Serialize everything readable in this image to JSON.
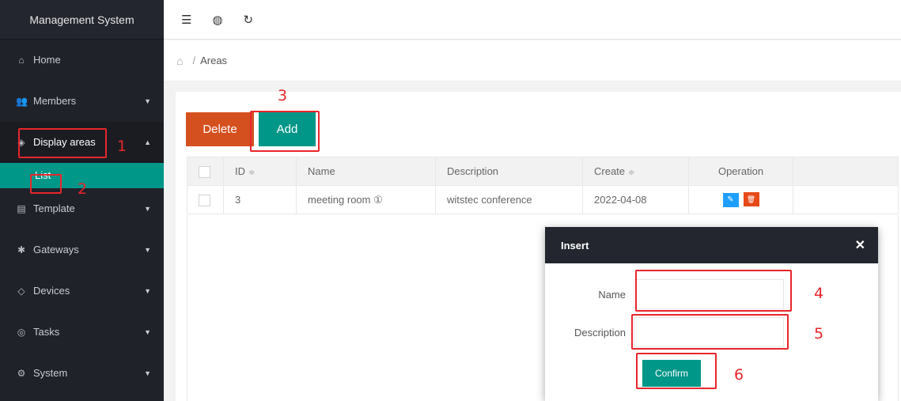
{
  "sidebar": {
    "brand": "Management System",
    "items": [
      {
        "label": "Home",
        "icon": "home-icon",
        "glyph": "⌂"
      },
      {
        "label": "Members",
        "icon": "members-icon",
        "glyph": "👥"
      },
      {
        "label": "Display areas",
        "icon": "layers-icon",
        "glyph": "◈"
      },
      {
        "label": "Template",
        "icon": "template-icon",
        "glyph": "▤"
      },
      {
        "label": "Gateways",
        "icon": "gateway-icon",
        "glyph": "✱"
      },
      {
        "label": "Devices",
        "icon": "tag-icon",
        "glyph": "◇"
      },
      {
        "label": "Tasks",
        "icon": "target-icon",
        "glyph": "◎"
      },
      {
        "label": "System",
        "icon": "gear-icon",
        "glyph": "⚙"
      }
    ],
    "sub_items": [
      {
        "label": "List"
      }
    ]
  },
  "topbar": {
    "menu_icon": "☰",
    "globe_icon": "◍",
    "refresh_icon": "↻"
  },
  "breadcrumb": {
    "home_icon": "⌂",
    "separator": "/",
    "current": "Areas"
  },
  "toolbar": {
    "delete_label": "Delete",
    "add_label": "Add"
  },
  "table": {
    "headers": [
      "ID",
      "Name",
      "Description",
      "Create",
      "Operation"
    ],
    "sort_icon": "≑",
    "rows": [
      {
        "id": "3",
        "name": "meeting room ①",
        "description": "witstec conference",
        "create": "2022-04-08"
      }
    ],
    "edit_icon": "✎",
    "delete_icon": "🗑"
  },
  "modal": {
    "title": "Insert",
    "close_icon": "✕",
    "name_label": "Name",
    "name_value": "",
    "description_label": "Description",
    "description_value": "",
    "confirm_label": "Confirm"
  },
  "annotations": [
    "1",
    "2",
    "3",
    "4",
    "5",
    "6"
  ],
  "colors": {
    "accent": "#009688",
    "danger": "#d4501f",
    "sidebar": "#20222a",
    "annotation": "#e8262b"
  }
}
